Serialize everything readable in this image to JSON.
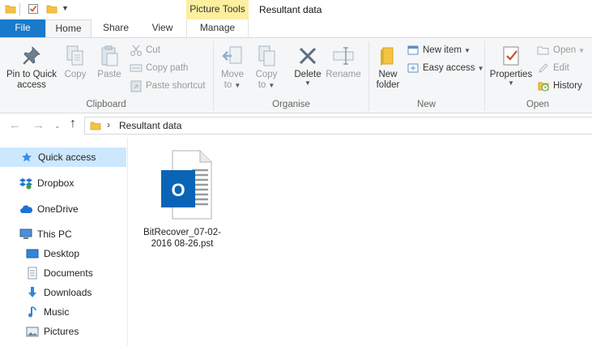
{
  "window": {
    "title": "Resultant data",
    "context_tab_header": "Picture Tools"
  },
  "tabs": [
    {
      "label": "File"
    },
    {
      "label": "Home"
    },
    {
      "label": "Share"
    },
    {
      "label": "View"
    },
    {
      "label": "Manage"
    }
  ],
  "ribbon": {
    "clipboard": {
      "pin_label_1": "Pin to Quick",
      "pin_label_2": "access",
      "copy": "Copy",
      "paste": "Paste",
      "cut": "Cut",
      "copy_path": "Copy path",
      "paste_shortcut": "Paste shortcut",
      "group": "Clipboard"
    },
    "organise": {
      "move_to_1": "Move",
      "move_to_2": "to",
      "copy_to_1": "Copy",
      "copy_to_2": "to",
      "delete": "Delete",
      "rename": "Rename",
      "group": "Organise"
    },
    "new": {
      "new_folder_1": "New",
      "new_folder_2": "folder",
      "new_item": "New item",
      "easy_access": "Easy access",
      "group": "New"
    },
    "open": {
      "properties": "Properties",
      "open": "Open",
      "edit": "Edit",
      "history": "History",
      "group": "Open"
    }
  },
  "address": {
    "path": "Resultant data"
  },
  "nav_pane": {
    "items": [
      {
        "label": "Quick access"
      },
      {
        "label": "Dropbox"
      },
      {
        "label": "OneDrive"
      },
      {
        "label": "This PC"
      },
      {
        "label": "Desktop"
      },
      {
        "label": "Documents"
      },
      {
        "label": "Downloads"
      },
      {
        "label": "Music"
      },
      {
        "label": "Pictures"
      }
    ]
  },
  "files": [
    {
      "name": "BitRecover_07-02-2016 08-26.pst",
      "icon": "outlook-pst-icon",
      "icon_letter": "O"
    }
  ],
  "colors": {
    "file_tab": "#1979ca",
    "context_tab": "#fcef9f",
    "selection": "#cce8ff",
    "outlook_blue": "#0a64b6"
  }
}
